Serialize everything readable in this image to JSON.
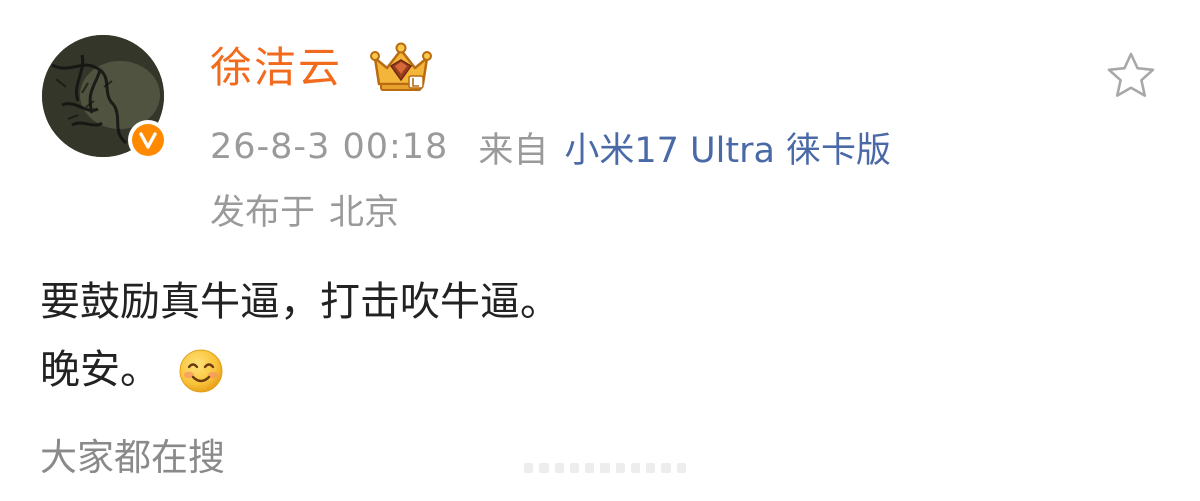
{
  "author": {
    "name": "徐洁云",
    "verified_badge_icon": "verified-v-icon",
    "vip_icon": "crown-vip-icon"
  },
  "meta": {
    "time": "26-8-3 00:18",
    "from_label": "来自",
    "device": "小米17 Ultra 徕卡版",
    "location_label": "发布于",
    "location": "北京"
  },
  "post": {
    "line1": "要鼓励真牛逼，打击吹牛逼。",
    "line2": "晚安。",
    "emoji_icon": "smile-emoji-icon"
  },
  "actions": {
    "favorite_icon": "star-outline-icon"
  },
  "trending": {
    "label": "大家都在搜"
  },
  "colors": {
    "name": "#f26a1b",
    "meta": "#9a9a9a",
    "device_link": "#4a69a7",
    "text": "#222222",
    "badge": "#ff8a00"
  }
}
